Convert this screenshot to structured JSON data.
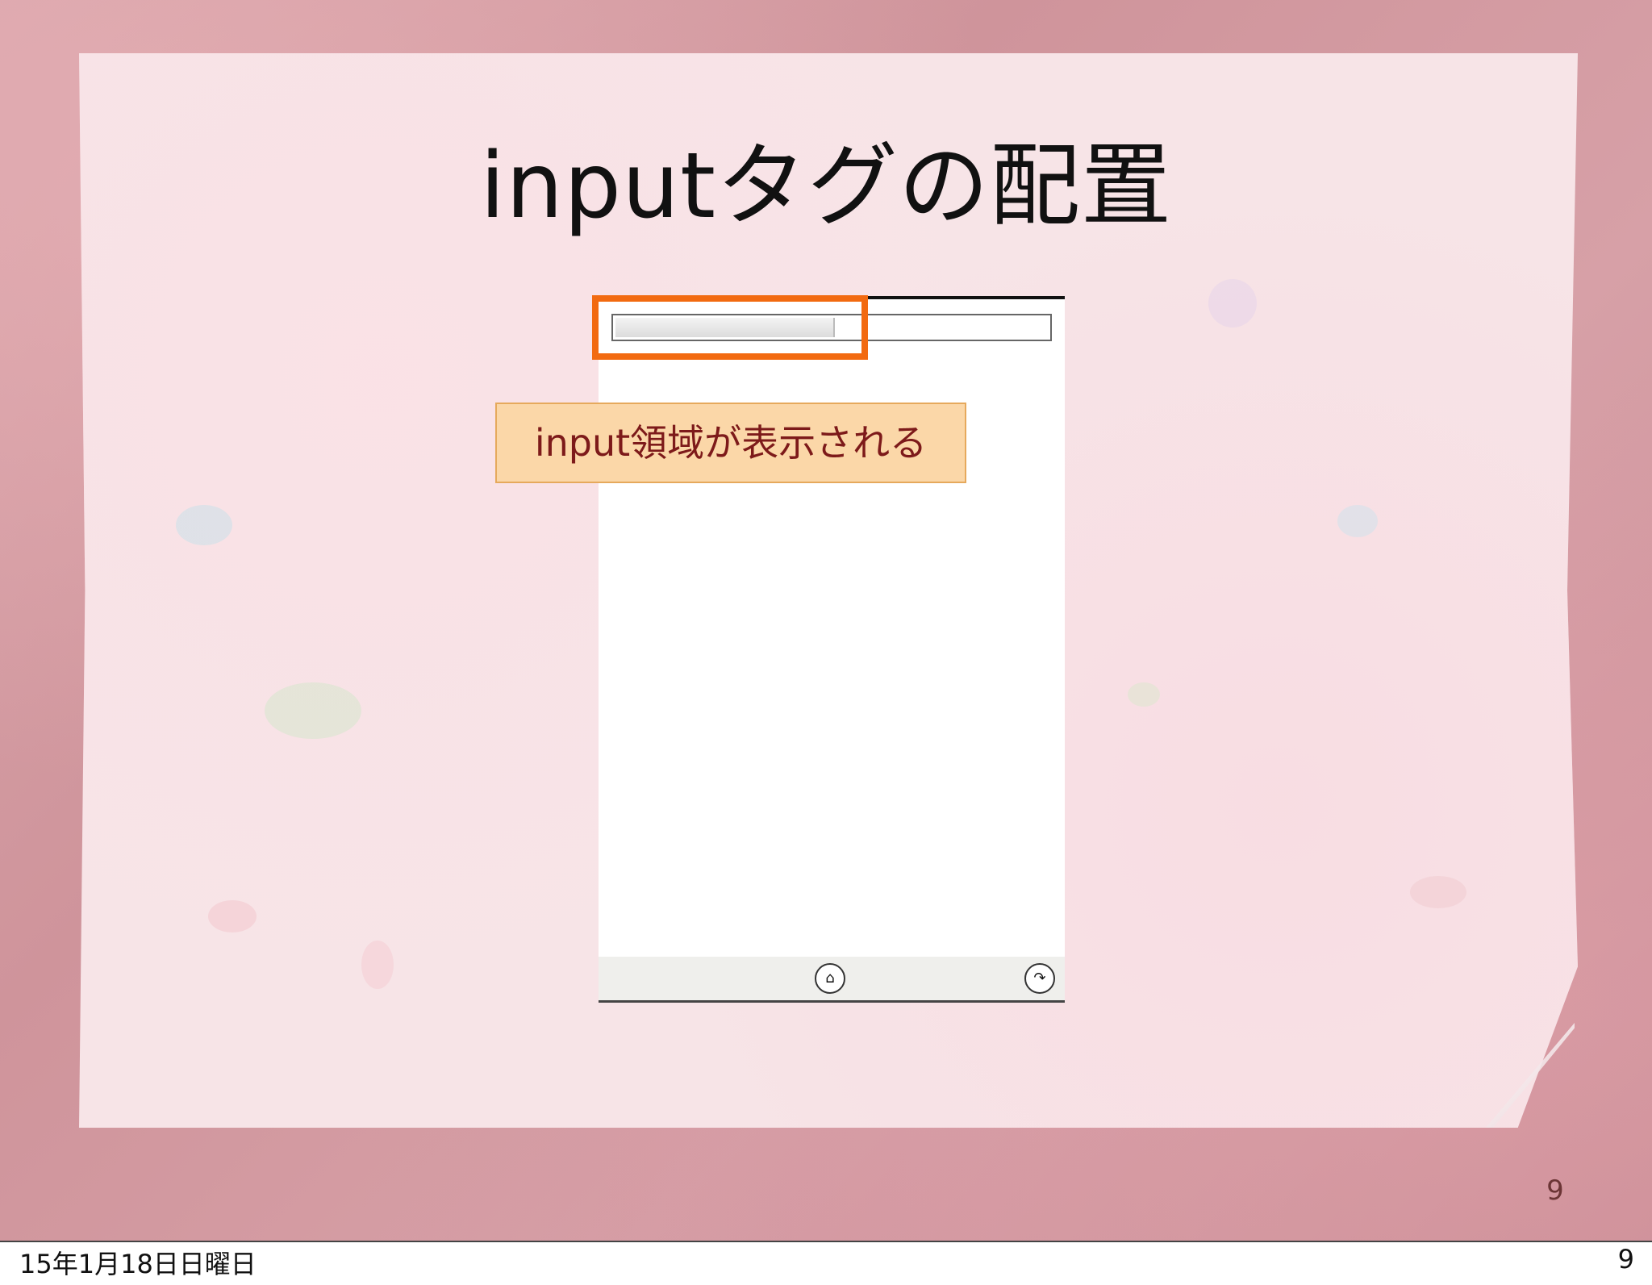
{
  "slide": {
    "title": "inputタグの配置",
    "callout_text": "input領域が表示される",
    "slide_number": "9"
  },
  "phone_mock": {
    "toolbar_buttons": [
      {
        "icon": "home-icon",
        "glyph": "⌂"
      },
      {
        "icon": "forward-icon",
        "glyph": "↷"
      }
    ]
  },
  "footer": {
    "date": "15年1月18日日曜日",
    "page": "9"
  },
  "colors": {
    "highlight_border": "#f26a10",
    "callout_background": "#fbd7a8",
    "callout_text": "#7d1a1a",
    "frame_background": "#d19aa1",
    "paper_background": "#f7e4e7"
  }
}
